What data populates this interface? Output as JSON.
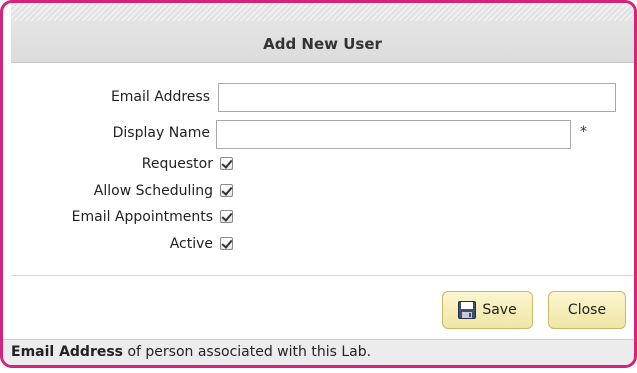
{
  "dialog": {
    "title": "Add New User"
  },
  "form": {
    "email_label": "Email Address",
    "email_value": "",
    "display_name_label": "Display Name",
    "display_name_value": "",
    "required_marker": "*",
    "checkboxes": [
      {
        "label": "Requestor",
        "checked": true
      },
      {
        "label": "Allow Scheduling",
        "checked": true
      },
      {
        "label": "Email Appointments",
        "checked": true
      },
      {
        "label": "Active",
        "checked": true
      }
    ]
  },
  "buttons": {
    "save_label": "Save",
    "close_label": "Close",
    "save_icon": "floppy-disk-icon"
  },
  "status": {
    "field_name": "Email Address",
    "message": " of person associated with this Lab."
  },
  "colors": {
    "frame_border": "#d4237a",
    "button_bg": "#f5edb8"
  }
}
